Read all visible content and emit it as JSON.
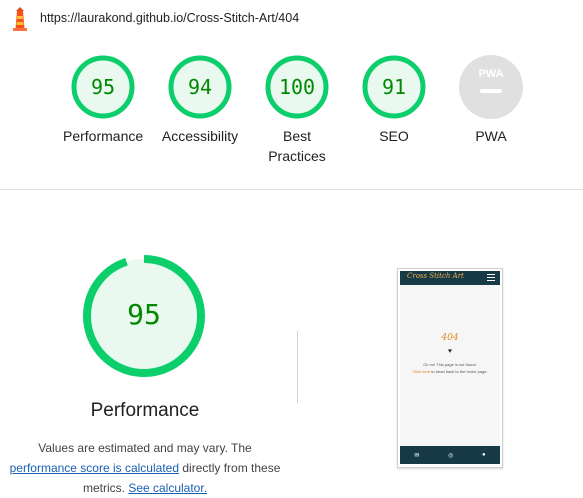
{
  "header": {
    "url": "https://laurakond.github.io/Cross-Stitch-Art/404"
  },
  "gauges": [
    {
      "score": "95",
      "label": "Performance"
    },
    {
      "score": "94",
      "label": "Accessibility"
    },
    {
      "score": "100",
      "label_line1": "Best",
      "label_line2": "Practices"
    },
    {
      "score": "91",
      "label": "SEO"
    },
    {
      "badge": "PWA",
      "label": "PWA"
    }
  ],
  "main": {
    "score": "95",
    "title": "Performance",
    "desc_part1": "Values are estimated and may vary. The",
    "desc_link1": "performance score is calculated",
    "desc_part2": "directly from these",
    "desc_part3": "metrics.",
    "desc_link2": "See calculator."
  },
  "preview": {
    "brand": "Cross Stitch Art",
    "heading": "404",
    "heart": "♥",
    "line1": "Oh no! This page is not found.",
    "line2_highlight": "Click here",
    "line2_rest": " to head back to the home page.",
    "footer_icons": [
      "✉",
      "◎",
      "●"
    ]
  },
  "colors": {
    "pass": "#0cce6b",
    "pass_bg": "#e9f9ef",
    "pass_text": "#008800",
    "pwa_gray": "#e0e0e0"
  }
}
